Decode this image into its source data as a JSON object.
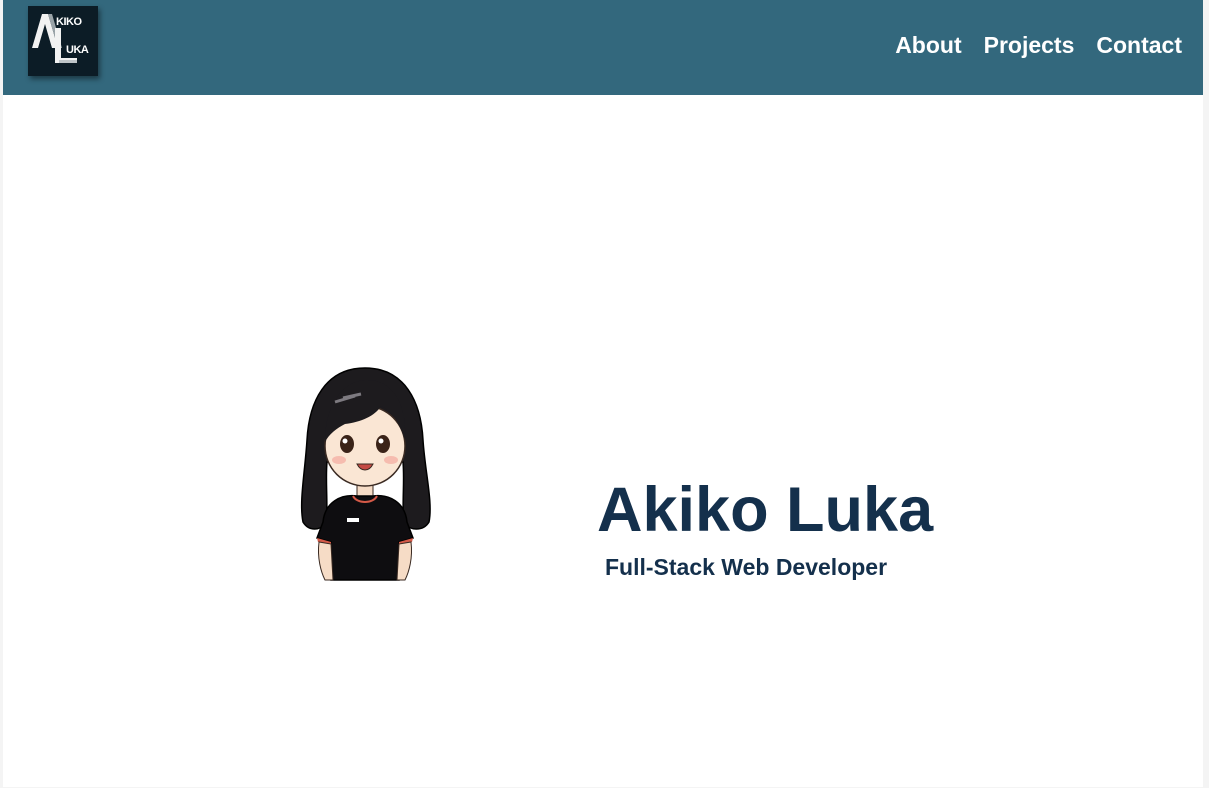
{
  "header": {
    "logo": {
      "line1": "KIKO",
      "line2": "UKA",
      "icon": "akiko-luka-monogram-logo"
    },
    "nav": [
      {
        "label": "About"
      },
      {
        "label": "Projects"
      },
      {
        "label": "Contact"
      }
    ]
  },
  "hero": {
    "name": "Akiko Luka",
    "title": "Full-Stack Web Developer",
    "avatar_icon": "chibi-girl-avatar"
  },
  "colors": {
    "header_bg": "#33687d",
    "heading_text": "#14304c",
    "logo_bg": "#0c1c26",
    "nav_text": "#ffffff"
  }
}
